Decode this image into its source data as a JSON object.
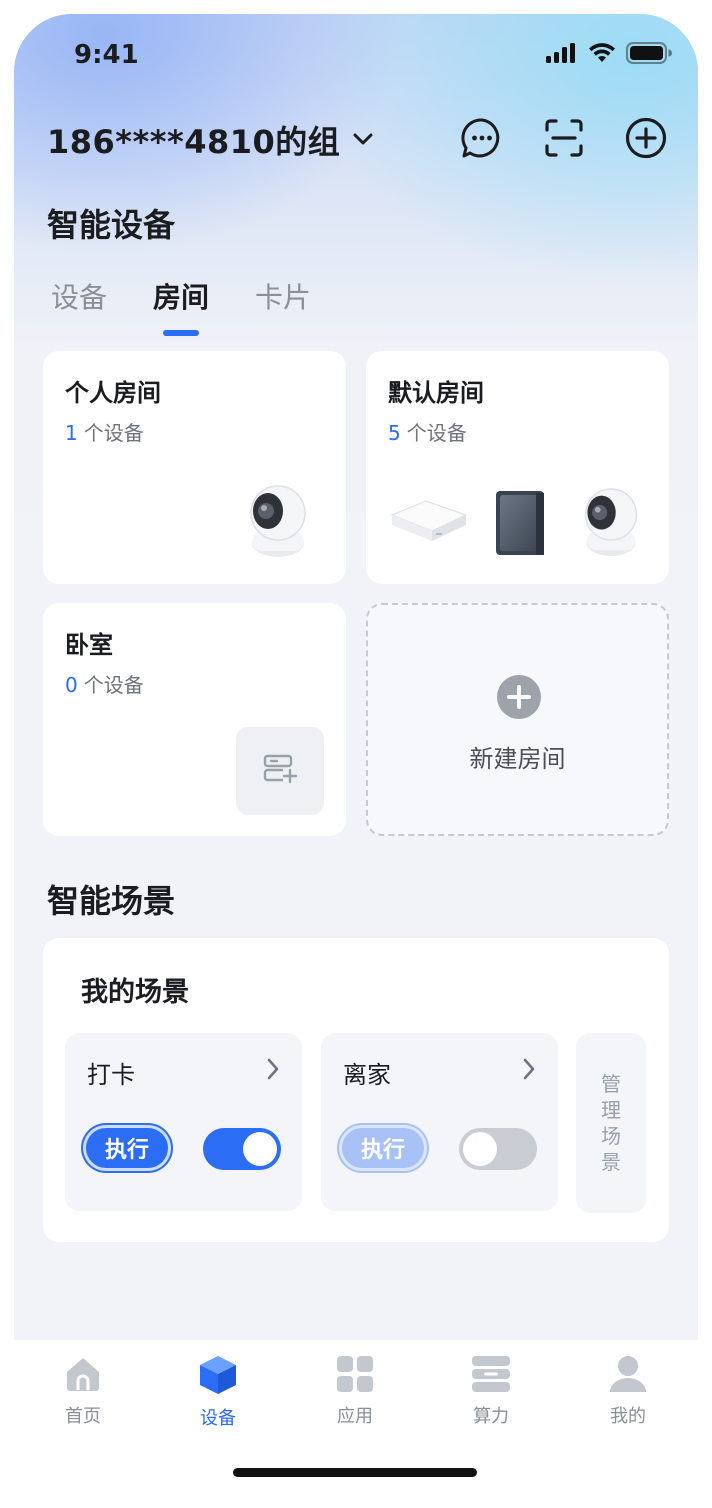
{
  "status_bar": {
    "time": "9:41"
  },
  "header": {
    "group_name": "186****4810的组"
  },
  "section_devices": {
    "title": "智能设备",
    "tabs": [
      {
        "label": "设备",
        "active": false
      },
      {
        "label": "房间",
        "active": true
      },
      {
        "label": "卡片",
        "active": false
      }
    ]
  },
  "rooms": [
    {
      "name": "个人房间",
      "count": "1",
      "unit": "个设备"
    },
    {
      "name": "默认房间",
      "count": "5",
      "unit": "个设备"
    },
    {
      "name": "卧室",
      "count": "0",
      "unit": "个设备"
    }
  ],
  "new_room": {
    "label": "新建房间"
  },
  "section_scenes": {
    "title": "智能场景",
    "card_title": "我的场景",
    "scenes": [
      {
        "name": "打卡",
        "run_label": "执行",
        "enabled": true
      },
      {
        "name": "离家",
        "run_label": "执行",
        "enabled": false
      }
    ],
    "manage_label": [
      "管",
      "理",
      "场",
      "景"
    ]
  },
  "tabbar": {
    "items": [
      {
        "label": "首页",
        "icon": "home-icon",
        "active": false
      },
      {
        "label": "设备",
        "icon": "device-cube-icon",
        "active": true
      },
      {
        "label": "应用",
        "icon": "apps-grid-icon",
        "active": false
      },
      {
        "label": "算力",
        "icon": "compute-server-icon",
        "active": false
      },
      {
        "label": "我的",
        "icon": "profile-icon",
        "active": false
      }
    ]
  },
  "colors": {
    "accent": "#2b6df5",
    "accent_disabled": "#a8c2f7",
    "text_primary": "#1b1c20",
    "text_secondary": "#8a8f99",
    "toggle_off": "#c9ccd2"
  }
}
